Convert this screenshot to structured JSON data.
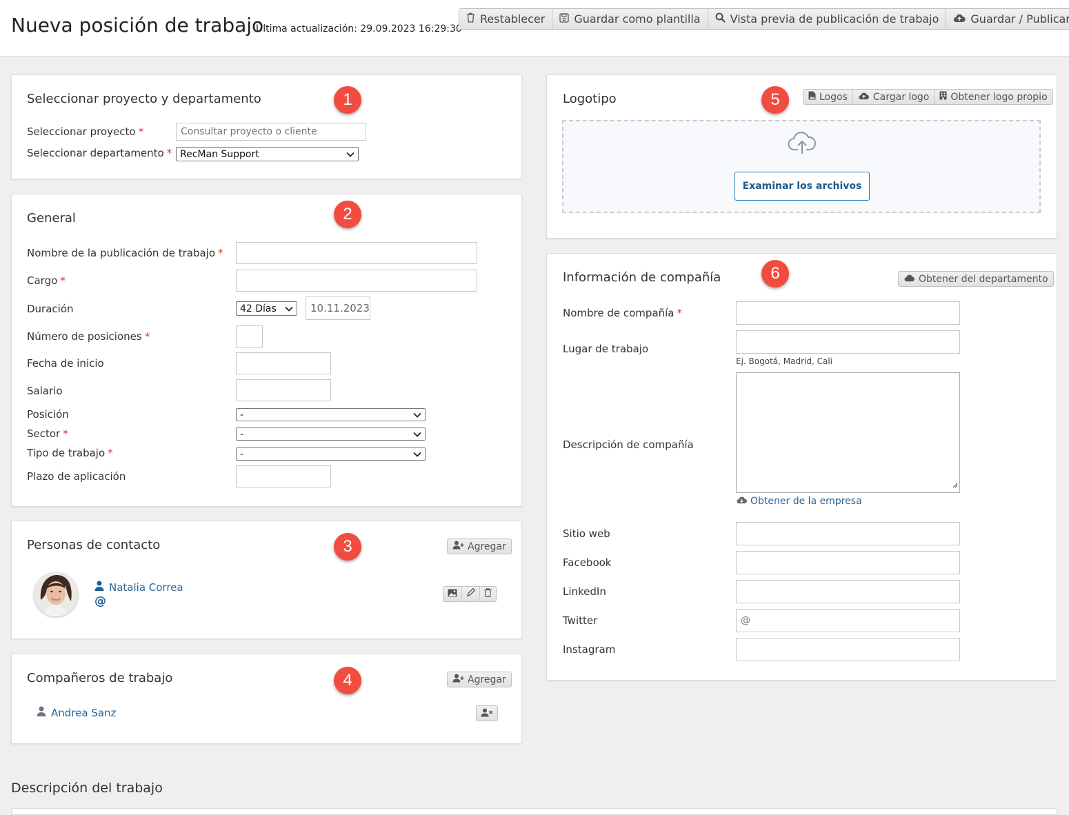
{
  "header": {
    "title": "Nueva posición de trabajo",
    "last_update": "Última actualización: 29.09.2023 16:29:30",
    "toolbar": {
      "reset": "Restablecer",
      "save_template": "Guardar como plantilla",
      "preview": "Vista previa de publicación de trabajo",
      "save_publish": "Guardar / Publicar"
    }
  },
  "project_panel": {
    "badge": "1",
    "title": "Seleccionar proyecto y departamento",
    "project_label": "Seleccionar proyecto",
    "project_placeholder": "Consultar proyecto o cliente",
    "department_label": "Seleccionar departamento",
    "department_value": "RecMan Support"
  },
  "general_panel": {
    "badge": "2",
    "title": "General",
    "job_name_label": "Nombre de la publicación de trabajo",
    "role_label": "Cargo",
    "duration_label": "Duración",
    "duration_value": "42 Días",
    "duration_date": "10.11.2023",
    "positions_label": "Número de posiciones",
    "start_date_label": "Fecha de inicio",
    "salary_label": "Salario",
    "position_label": "Posición",
    "position_value": "-",
    "sector_label": "Sector",
    "sector_value": "-",
    "job_type_label": "Tipo de trabajo",
    "job_type_value": "-",
    "deadline_label": "Plazo de aplicación"
  },
  "contacts_panel": {
    "badge": "3",
    "title": "Personas de contacto",
    "add_label": "Agregar",
    "contact_name": "Natalia Correa",
    "contact_email_symbol": "@"
  },
  "coworkers_panel": {
    "badge": "4",
    "title": "Compañeros de trabajo",
    "add_label": "Agregar",
    "coworker_name": "Andrea Sanz"
  },
  "logo_panel": {
    "badge": "5",
    "title": "Logotipo",
    "logos_label": "Logos",
    "upload_label": "Cargar logo",
    "own_logo_label": "Obtener logo propio",
    "browse_label": "Examinar los archivos"
  },
  "company_panel": {
    "badge": "6",
    "title": "Información de compañía",
    "from_department_label": "Obtener del departamento",
    "company_name_label": "Nombre de compañía",
    "workplace_label": "Lugar de trabajo",
    "workplace_hint": "Ej. Bogotá, Madrid, Cali",
    "description_label": "Descripción de compañía",
    "from_company_label": "Obtener de la empresa",
    "website_label": "Sitio web",
    "facebook_label": "Facebook",
    "linkedin_label": "LinkedIn",
    "twitter_label": "Twitter",
    "twitter_placeholder": "@",
    "instagram_label": "Instagram"
  },
  "job_description": {
    "title": "Descripción del trabajo"
  },
  "colors": {
    "badge": "#f24b3f",
    "required": "#d9332b",
    "link": "#2a6496",
    "primary_button": "#1d5b8f"
  }
}
